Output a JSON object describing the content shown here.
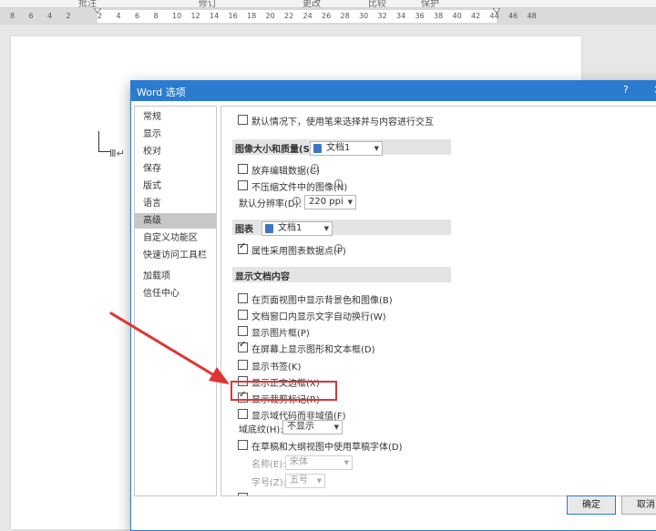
{
  "ribbon": {
    "labels": [
      "批注",
      "修订",
      "更改",
      "比较",
      "保护"
    ]
  },
  "ruler": {
    "ticks": [
      "8",
      "6",
      "4",
      "2",
      "2",
      "4",
      "6",
      "8",
      "10",
      "12",
      "14",
      "16",
      "18",
      "20",
      "22",
      "24",
      "26",
      "28",
      "30",
      "32",
      "34",
      "36",
      "38",
      "40",
      "42",
      "44",
      "46",
      "48"
    ]
  },
  "document": {
    "paragraph_mark": "Ⅲ↵"
  },
  "dialog": {
    "title": "Word 选项",
    "help": "?",
    "close": "×",
    "nav": {
      "items": [
        "常规",
        "显示",
        "校对",
        "保存",
        "版式",
        "语言",
        "高级",
        "自定义功能区",
        "快速访问工具栏",
        "加载项",
        "信任中心"
      ],
      "selected": "高级"
    },
    "content": {
      "pen_option": "默认情况下，使用笔来选择并与内容进行交互",
      "image_section": {
        "title": "图像大小和质量(S)",
        "doc_combo": "文档1",
        "discard_edit": "放弃编辑数据(C)",
        "no_compress": "不压缩文件中的图像(N)",
        "resolution_label": "默认分辨率(D):",
        "resolution_value": "220 ppi"
      },
      "chart_section": {
        "title": "图表",
        "doc_combo": "文档1",
        "property_follow": "属性采用图表数据点(P)"
      },
      "display_section": {
        "title": "显示文档内容",
        "options": [
          {
            "label": "在页面视图中显示背景色和图像(B)",
            "checked": false
          },
          {
            "label": "文档窗口内显示文字自动换行(W)",
            "checked": false
          },
          {
            "label": "显示图片框(P)",
            "checked": false
          },
          {
            "label": "在屏幕上显示图形和文本框(D)",
            "checked": true
          },
          {
            "label": "显示书签(K)",
            "checked": false
          },
          {
            "label": "显示正文边框(X)",
            "checked": false
          },
          {
            "label": "显示裁剪标记(R)",
            "checked": true
          },
          {
            "label": "显示域代码而非域值(F)",
            "checked": false
          }
        ],
        "field_shading_label": "域底纹(H):",
        "field_shading_value": "不显示",
        "draft_font": "在草稿和大纲视图中使用草稿字体(D)",
        "font_name_label": "名称(E):",
        "font_name_value": "宋体",
        "font_size_label": "字号(Z):",
        "font_size_value": "五号"
      }
    },
    "ok": "确定",
    "cancel": "取消"
  },
  "colors": {
    "accent": "#2b7bd0",
    "highlight": "#e03434",
    "arrow": "#e03434"
  }
}
